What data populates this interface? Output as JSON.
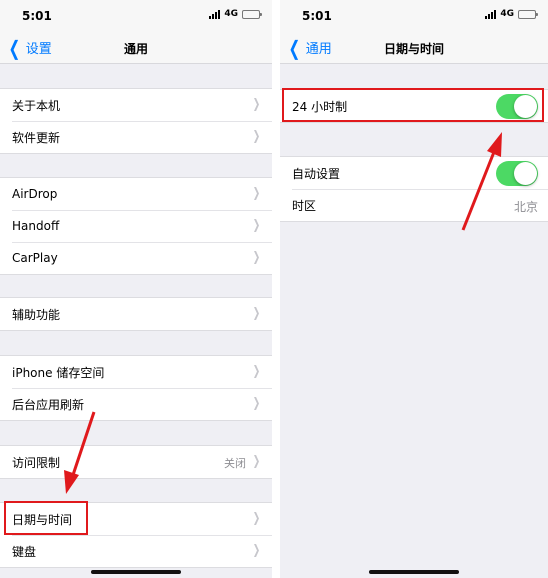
{
  "left": {
    "status": {
      "time": "5:01",
      "network": "4G"
    },
    "nav": {
      "back_label": "设置",
      "title": "通用"
    },
    "groups": [
      [
        "关于本机",
        "软件更新"
      ],
      [
        "AirDrop",
        "Handoff",
        "CarPlay"
      ],
      [
        "辅助功能"
      ],
      [
        "iPhone 储存空间",
        "后台应用刷新"
      ],
      [
        "访问限制"
      ],
      [
        "日期与时间",
        "键盘"
      ]
    ],
    "restrictions_value": "关闭"
  },
  "right": {
    "status": {
      "time": "5:01",
      "network": "4G"
    },
    "nav": {
      "back_label": "通用",
      "title": "日期与时间"
    },
    "rows": {
      "hour24_label": "24 小时制",
      "hour24_on": true,
      "auto_set_label": "自动设置",
      "auto_set_on": true,
      "timezone_label": "时区",
      "timezone_value": "北京"
    }
  },
  "colors": {
    "accent": "#007aff",
    "toggle_on": "#4cd964",
    "highlight": "#e0191c",
    "battery": "#f5c518"
  }
}
